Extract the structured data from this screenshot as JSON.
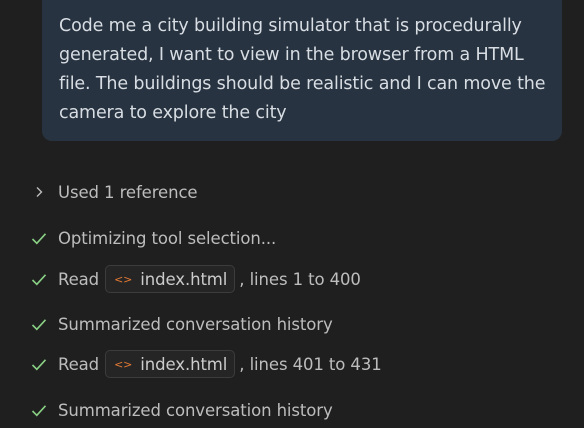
{
  "prompt": {
    "text": "Code me a city building simulator that is procedurally generated, I want to view in the browser from a HTML file. The buildings should be realistic and I can move the camera to explore the city"
  },
  "references": {
    "label": "Used 1 reference",
    "icon": "chevron-right-icon"
  },
  "steps": [
    {
      "icon": "check-icon",
      "text": "Optimizing tool selection..."
    },
    {
      "icon": "check-icon",
      "prefix": "Read",
      "file": "index.html",
      "suffix": ", lines 1 to 400"
    },
    {
      "icon": "check-icon",
      "text": "Summarized conversation history"
    },
    {
      "icon": "check-icon",
      "prefix": "Read",
      "file": "index.html",
      "suffix": ", lines 401 to 431"
    },
    {
      "icon": "check-icon",
      "text": "Summarized conversation history"
    }
  ],
  "colors": {
    "background": "#1f1f1f",
    "bubble": "#273340",
    "check": "#89d185",
    "file_icon": "#e37933",
    "text": "#bdbdbd"
  }
}
